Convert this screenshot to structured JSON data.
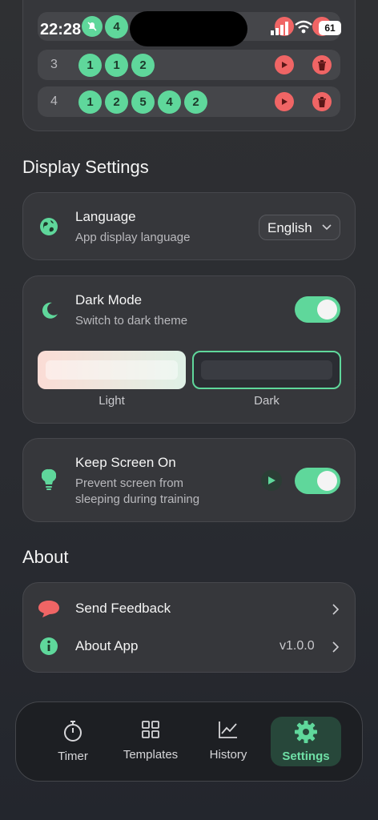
{
  "status_bar": {
    "time": "22:28",
    "battery": "61"
  },
  "rounds": [
    {
      "num": "3",
      "values": [
        "1",
        "1",
        "2"
      ]
    },
    {
      "num": "4",
      "values": [
        "1",
        "2",
        "5",
        "4",
        "2"
      ]
    }
  ],
  "top_row_values": [
    "4"
  ],
  "display_settings": {
    "heading": "Display Settings",
    "language": {
      "title": "Language",
      "subtitle": "App display language",
      "value": "English"
    },
    "dark_mode": {
      "title": "Dark Mode",
      "subtitle": "Switch to dark theme",
      "enabled": true,
      "themes": [
        {
          "label": "Light"
        },
        {
          "label": "Dark"
        }
      ]
    },
    "keep_screen": {
      "title": "Keep Screen On",
      "subtitle_line1": "Prevent screen from",
      "subtitle_line2": "sleeping during training",
      "enabled": true
    }
  },
  "about": {
    "heading": "About",
    "feedback": "Send Feedback",
    "about_app": "About App",
    "version": "v1.0.0"
  },
  "tabs": [
    {
      "label": "Timer",
      "icon": "stopwatch-icon"
    },
    {
      "label": "Templates",
      "icon": "grid-icon"
    },
    {
      "label": "History",
      "icon": "chart-icon"
    },
    {
      "label": "Settings",
      "icon": "gear-icon",
      "active": true
    }
  ],
  "colors": {
    "accent": "#5fd79b",
    "danger": "#f06565",
    "card": "#36373b"
  }
}
